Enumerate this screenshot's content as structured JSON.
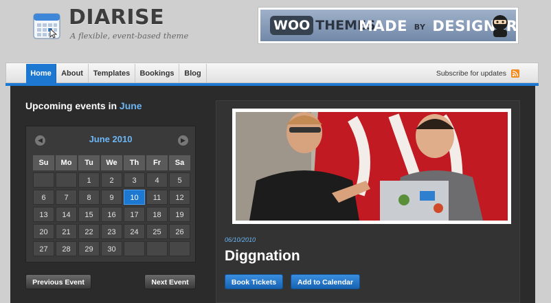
{
  "site": {
    "title": "DIARISE",
    "tagline": "A flexible, event-based theme"
  },
  "ad": {
    "woo": "WOO",
    "themes": "THEMES",
    "made": "MADE",
    "by": "BY",
    "designers": "DESIGNERS"
  },
  "nav": {
    "items": [
      {
        "label": "Home",
        "active": true
      },
      {
        "label": "About",
        "active": false
      },
      {
        "label": "Templates",
        "active": false
      },
      {
        "label": "Bookings",
        "active": false
      },
      {
        "label": "Blog",
        "active": false
      }
    ],
    "subscribe": "Subscribe for updates"
  },
  "upcoming": {
    "prefix": "Upcoming events in",
    "month": "June"
  },
  "calendar": {
    "title": "June 2010",
    "weekdays": [
      "Su",
      "Mo",
      "Tu",
      "We",
      "Th",
      "Fr",
      "Sa"
    ],
    "first_weekday_index": 2,
    "days_in_month": 30,
    "selected_day": 10
  },
  "buttons": {
    "previous_event": "Previous Event",
    "next_event": "Next Event",
    "book_tickets": "Book Tickets",
    "add_to_calendar": "Add to Calendar"
  },
  "event": {
    "date": "06/10/2010",
    "title": "Diggnation"
  },
  "colors": {
    "accent": "#1d78d1",
    "link": "#6cb6f5",
    "panel": "#2b2b2b"
  }
}
